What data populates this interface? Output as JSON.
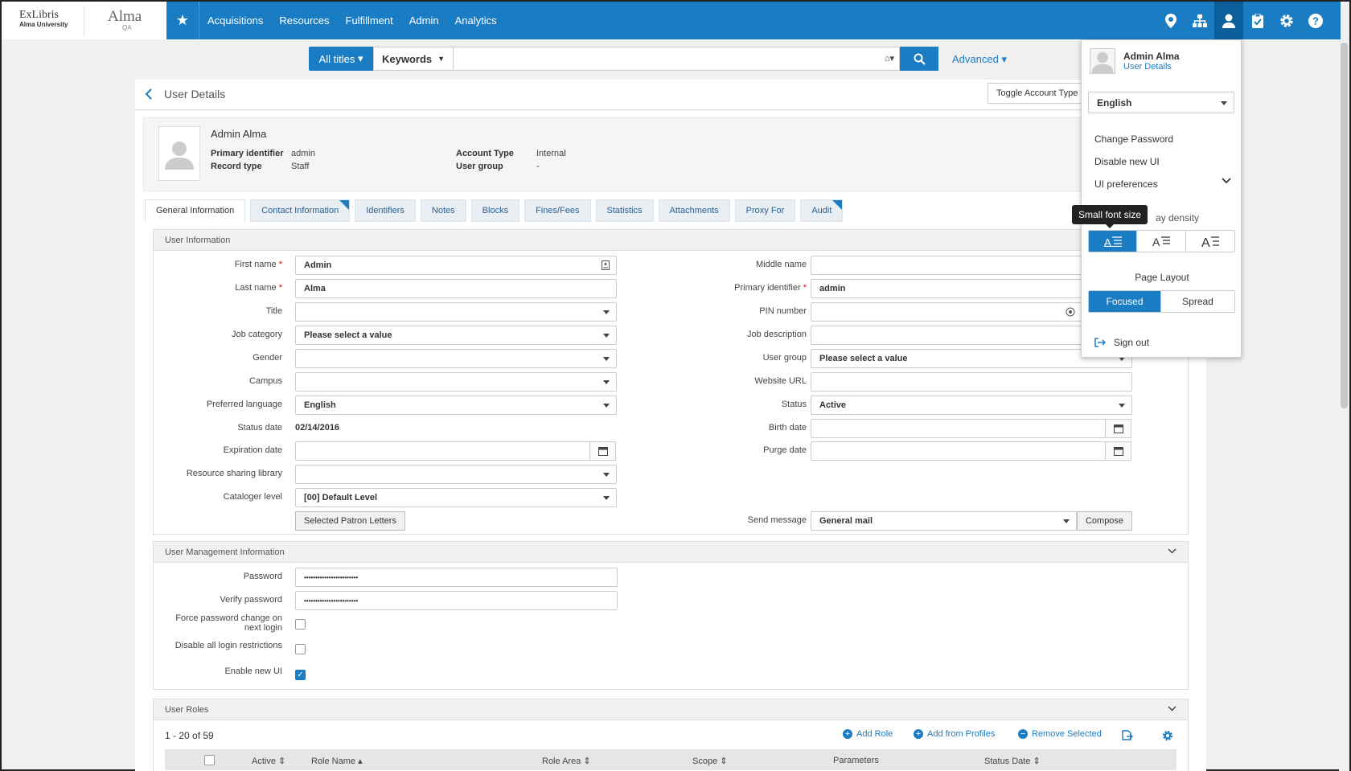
{
  "header": {
    "logo_exlibris": "ExLibris",
    "logo_university": "Alma University",
    "logo_alma": "Alma",
    "logo_env": "QA",
    "nav": [
      "Acquisitions",
      "Resources",
      "Fulfillment",
      "Admin",
      "Analytics"
    ]
  },
  "search": {
    "scope": "All titles",
    "field": "Keywords",
    "value": "",
    "advanced": "Advanced"
  },
  "page": {
    "title": "User Details",
    "toggle_account": "Toggle Account Type"
  },
  "summary": {
    "name": "Admin Alma",
    "primary_identifier_label": "Primary identifier",
    "primary_identifier": "admin",
    "record_type_label": "Record type",
    "record_type": "Staff",
    "account_type_label": "Account Type",
    "account_type": "Internal",
    "user_group_label": "User group",
    "user_group": "-"
  },
  "tabs": [
    "General Information",
    "Contact Information",
    "Identifiers",
    "Notes",
    "Blocks",
    "Fines/Fees",
    "Statistics",
    "Attachments",
    "Proxy For",
    "Audit"
  ],
  "user_info": {
    "section_title": "User Information",
    "first_name_label": "First name",
    "first_name": "Admin",
    "last_name_label": "Last name",
    "last_name": "Alma",
    "title_label": "Title",
    "title": "",
    "job_category_label": "Job category",
    "job_category": "Please select a value",
    "gender_label": "Gender",
    "gender": "",
    "campus_label": "Campus",
    "campus": "",
    "preferred_language_label": "Preferred language",
    "preferred_language": "English",
    "status_date_label": "Status date",
    "status_date": "02/14/2016",
    "expiration_date_label": "Expiration date",
    "expiration_date": "",
    "resource_sharing_label": "Resource sharing library",
    "resource_sharing": "",
    "cataloger_level_label": "Cataloger level",
    "cataloger_level": "[00] Default Level",
    "patron_letters_button": "Selected Patron Letters",
    "middle_name_label": "Middle name",
    "middle_name": "",
    "primary_identifier_label": "Primary identifier",
    "primary_identifier": "admin",
    "pin_label": "PIN number",
    "pin": "",
    "job_description_label": "Job description",
    "job_description": "",
    "user_group_label": "User group",
    "user_group": "Please select a value",
    "website_label": "Website URL",
    "website": "",
    "status_label": "Status",
    "status": "Active",
    "birth_date_label": "Birth date",
    "birth_date": "",
    "purge_date_label": "Purge date",
    "purge_date": "",
    "send_message_label": "Send message",
    "send_message": "General mail",
    "compose_button": "Compose"
  },
  "user_mgmt": {
    "section_title": "User Management Information",
    "password_label": "Password",
    "password": "••••••••••••••••••••••••",
    "verify_label": "Verify password",
    "verify": "••••••••••••••••••••••••",
    "force_change_label_1": "Force password change on",
    "force_change_label_2": "next login",
    "force_change": false,
    "disable_restrictions_label": "Disable all login restrictions",
    "disable_restrictions": false,
    "enable_new_ui_label": "Enable new UI",
    "enable_new_ui": true
  },
  "roles": {
    "section_title": "User Roles",
    "count": "1 - 20 of 59",
    "add_role": "Add Role",
    "add_from_profiles": "Add from Profiles",
    "remove_selected": "Remove Selected",
    "columns": [
      "Active",
      "Role Name",
      "Role Area",
      "Scope",
      "Parameters",
      "Status Date"
    ]
  },
  "user_menu": {
    "name": "Admin Alma",
    "details_link": "User Details",
    "language": "English",
    "change_password": "Change Password",
    "disable_new_ui": "Disable new UI",
    "ui_preferences": "UI preferences",
    "display_density_partial": "ay density",
    "page_layout_label": "Page Layout",
    "layout_options": [
      "Focused",
      "Spread"
    ],
    "layout_selected": "Focused",
    "sign_out": "Sign out",
    "tooltip": "Small font size"
  },
  "colors": {
    "primary": "#1a7dc4",
    "required": "#d00000"
  }
}
